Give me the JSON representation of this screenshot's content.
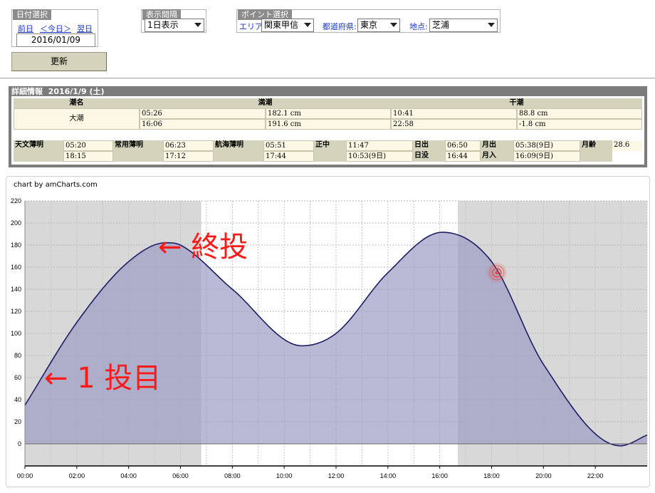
{
  "date_panel": {
    "legend": "日付選択",
    "prev_label": "前日",
    "today_label": "＜今日＞",
    "next_label": "翌日",
    "date_value": "2016/01/09"
  },
  "interval_panel": {
    "legend": "表示間隔",
    "selected": "1日表示"
  },
  "point_panel": {
    "legend": "ポイント選択",
    "area_label": "エリア:",
    "area_value": "関東甲信",
    "pref_label": "都道府県:",
    "pref_value": "東京",
    "spot_label": "地点:",
    "spot_value": "芝浦"
  },
  "update_button": "更新",
  "detail": {
    "title": "詳細情報",
    "date": "2016/1/9 (土)",
    "tide_name_header": "潮名",
    "high_header": "満潮",
    "low_header": "干潮",
    "tide_name": "大潮",
    "high": [
      {
        "time": "05:26",
        "level": "182.1 cm"
      },
      {
        "time": "16:06",
        "level": "191.6 cm"
      }
    ],
    "low": [
      {
        "time": "10:41",
        "level": "88.8 cm"
      },
      {
        "time": "22:58",
        "level": "-1.8 cm"
      }
    ],
    "astro": {
      "astro_twilight_label": "天文薄明",
      "astro_twilight": [
        "05:20",
        "18:15"
      ],
      "civil_twilight_label": "常用薄明",
      "civil_twilight": [
        "06:23",
        "17:12"
      ],
      "nautical_twilight_label": "航海薄明",
      "nautical_twilight": [
        "05:51",
        "17:44"
      ],
      "noon_label": "正中",
      "noon": [
        "11:47",
        "10:53(9日)"
      ],
      "sunrise_label": "日出",
      "sunrise": "06:50",
      "sunset_label": "日没",
      "sunset": "16:44",
      "moonrise_label": "月出",
      "moonrise": "05:38(9日)",
      "moonset_label": "月入",
      "moonset": "16:09(9日)",
      "moon_age_label": "月齢",
      "moon_age": "28.6"
    }
  },
  "chart_credit": "chart by amCharts.com",
  "annotations": {
    "last_cast": "← 終投",
    "first_cast": "← 1 投目"
  },
  "chart_data": {
    "type": "area",
    "x": [
      "00:00",
      "02:00",
      "04:00",
      "05:26",
      "06:00",
      "08:00",
      "10:41",
      "12:00",
      "14:00",
      "16:06",
      "18:00",
      "20:00",
      "22:58",
      "24:00"
    ],
    "xh": [
      0,
      2,
      4,
      5.433,
      6,
      8,
      10.683,
      12,
      14,
      16.1,
      18,
      20,
      22.967,
      24
    ],
    "y": [
      35,
      110,
      165,
      182.1,
      180,
      140,
      88.8,
      100,
      155,
      191.6,
      165,
      72,
      -1.8,
      8
    ],
    "xticks": [
      "00:00",
      "02:00",
      "04:00",
      "06:00",
      "08:00",
      "10:00",
      "12:00",
      "14:00",
      "16:00",
      "18:00",
      "20:00",
      "22:00"
    ],
    "yticks": [
      220,
      200,
      180,
      160,
      140,
      120,
      100,
      80,
      60,
      40,
      20,
      0
    ],
    "ylim": [
      -20,
      220
    ],
    "xlim_hours": [
      0,
      24
    ],
    "night_bands_hours": [
      [
        0,
        6.8
      ],
      [
        16.7,
        24
      ]
    ],
    "marker_hour": 18.2,
    "marker_value": 155,
    "line_color": "#1f1d64",
    "fill_color": "#9b9cc4",
    "night_color": "#d8d8d8",
    "marker_color": "#e05050",
    "grid": true
  }
}
